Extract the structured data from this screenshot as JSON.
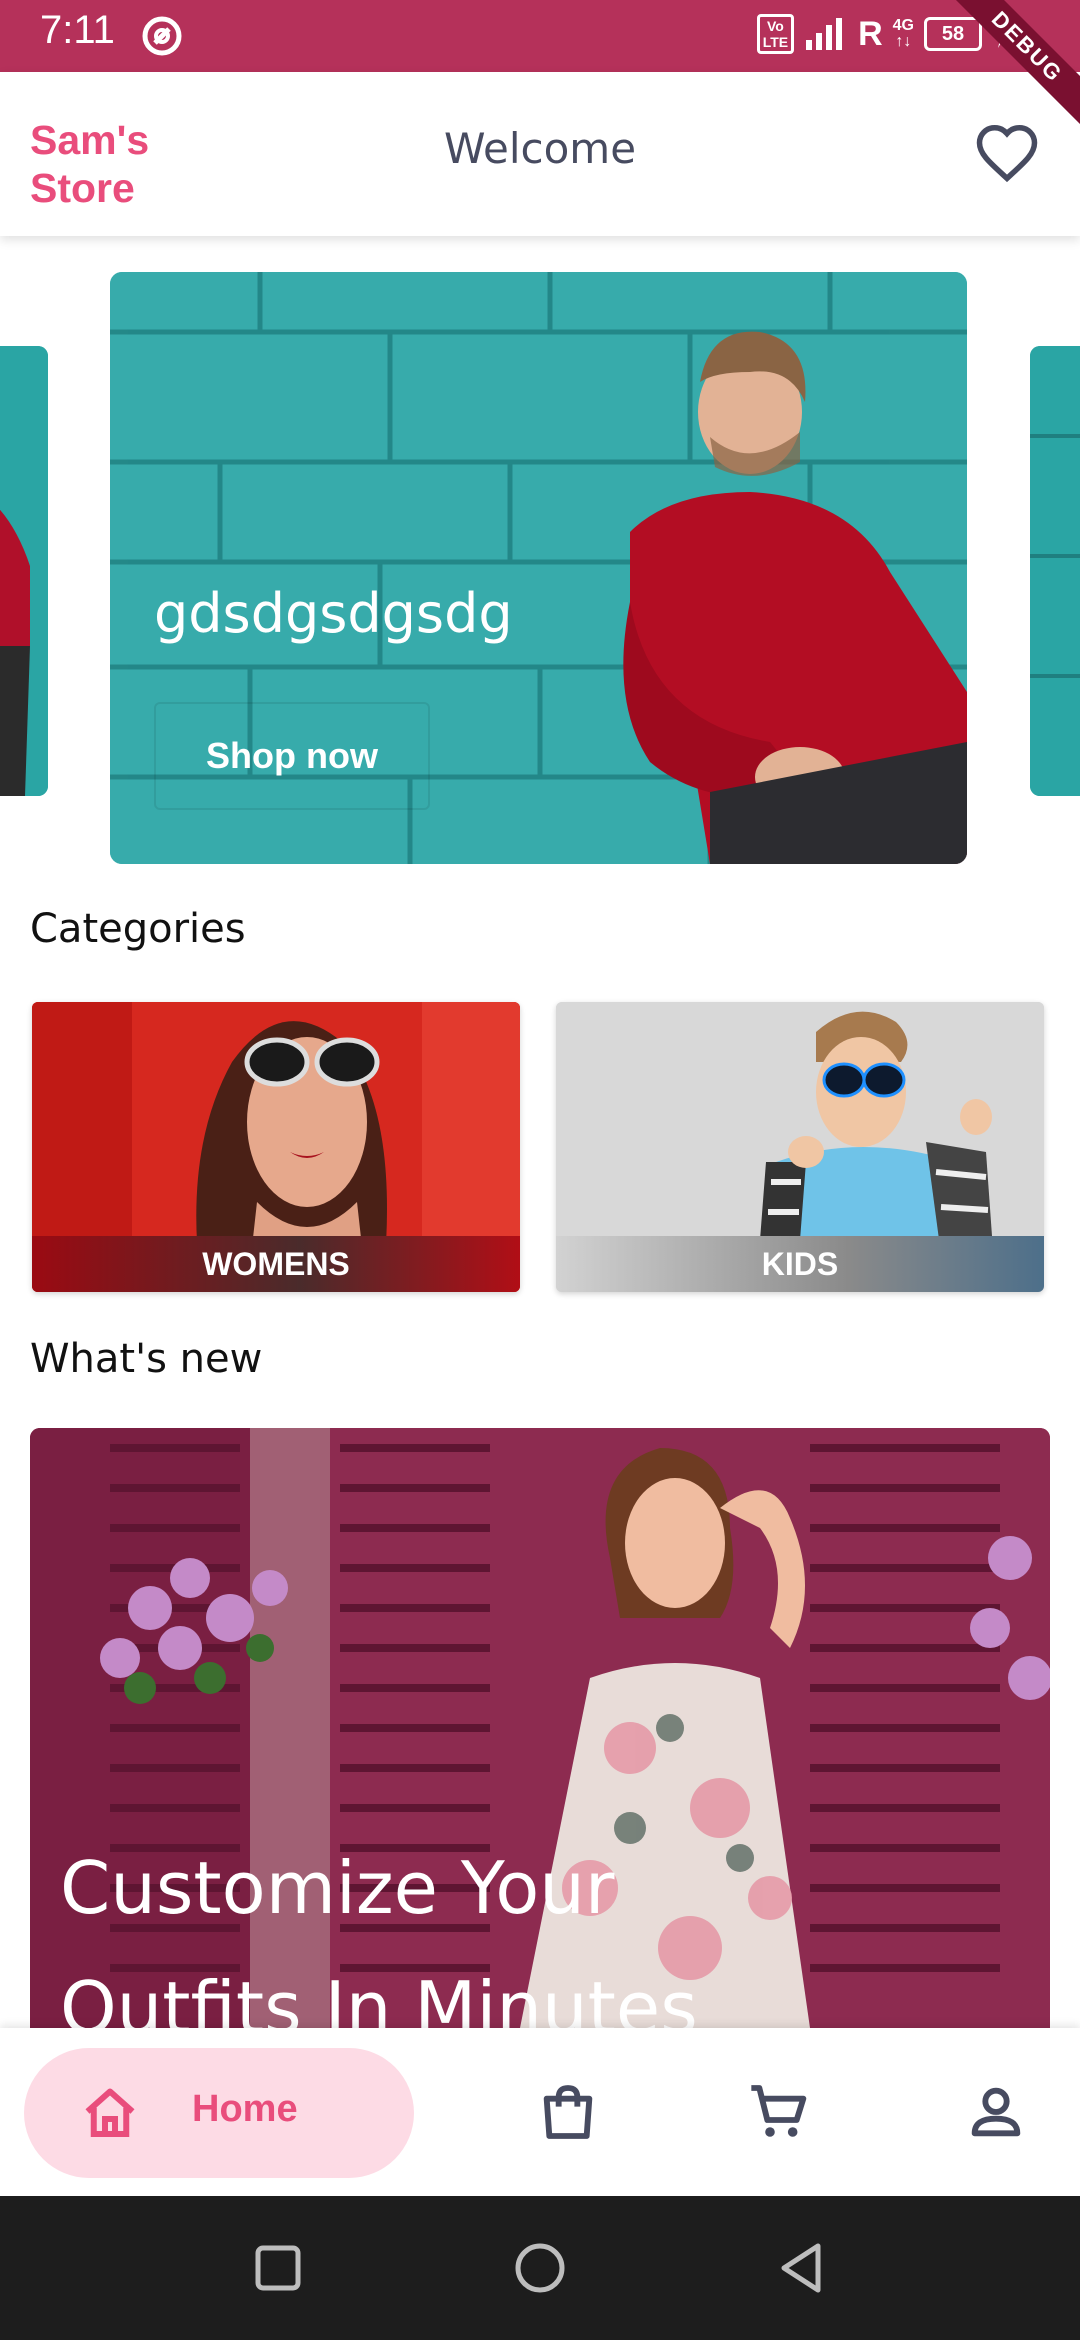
{
  "status_bar": {
    "time": "7:11",
    "volte_line1": "Vo",
    "volte_line2": "LTE",
    "roaming": "R",
    "network_top": "4G",
    "network_bottom": "↑↓",
    "battery": "58",
    "debug_banner": "DEBUG"
  },
  "app_bar": {
    "store_name": "Sam's Store",
    "title": "Welcome",
    "favorite_icon": "heart-outline-icon"
  },
  "carousel": {
    "main_caption": "gdsdgsdgsdg",
    "cta_label": "Shop now"
  },
  "sections": {
    "categories_title": "Categories",
    "whats_new_title": "What's new"
  },
  "categories": [
    {
      "label": "WOMENS"
    },
    {
      "label": "KIDS"
    }
  ],
  "whats_new": {
    "caption_line1": "Customize Your",
    "caption_line2": "Outfits In Minutes"
  },
  "bottom_nav": {
    "home_label": "Home",
    "icons": [
      "home-icon",
      "shopping-bag-icon",
      "cart-icon",
      "profile-icon"
    ]
  },
  "colors": {
    "status_bar": "#b5315a",
    "accent": "#e94d7c",
    "nav_pill": "#fddbe5"
  }
}
